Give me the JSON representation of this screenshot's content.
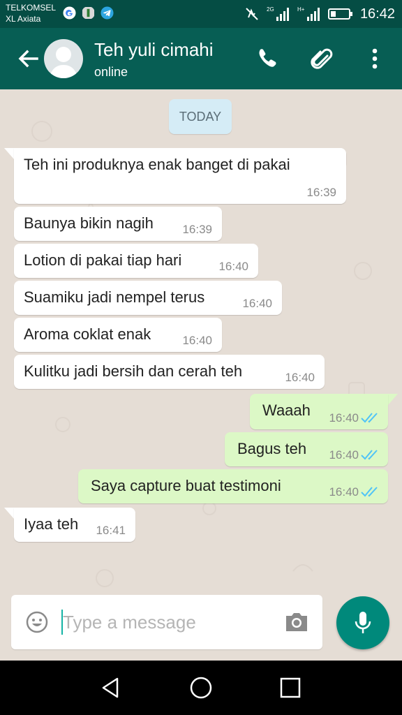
{
  "status_bar": {
    "carrier_1": "TELKOMSEL",
    "carrier_2": "XL Axiata",
    "network_1": "2G",
    "network_2": "H+",
    "time": "16:42"
  },
  "header": {
    "contact_name": "Teh yuli cimahi",
    "contact_status": "online",
    "icons": [
      "back-arrow-icon",
      "avatar",
      "phone-icon",
      "attach-icon",
      "more-icon"
    ]
  },
  "chat": {
    "date_chip": "TODAY",
    "messages": [
      {
        "dir": "in",
        "text": "Teh ini produknya enak banget di pakai",
        "time": "16:39"
      },
      {
        "dir": "in",
        "text": "Baunya bikin nagih",
        "time": "16:39"
      },
      {
        "dir": "in",
        "text": "Lotion di pakai tiap hari",
        "time": "16:40"
      },
      {
        "dir": "in",
        "text": "Suamiku jadi nempel terus",
        "time": "16:40"
      },
      {
        "dir": "in",
        "text": "Aroma coklat enak",
        "time": "16:40"
      },
      {
        "dir": "in",
        "text": "Kulitku jadi bersih dan cerah teh",
        "time": "16:40"
      },
      {
        "dir": "out",
        "text": "Waaah",
        "time": "16:40",
        "status": "read"
      },
      {
        "dir": "out",
        "text": "Bagus teh",
        "time": "16:40",
        "status": "read"
      },
      {
        "dir": "out",
        "text": "Saya capture buat testimoni",
        "time": "16:40",
        "status": "read"
      },
      {
        "dir": "in",
        "text": "Iyaa teh",
        "time": "16:41"
      }
    ]
  },
  "composer": {
    "placeholder": "Type a message"
  },
  "colors": {
    "header": "#075e54",
    "status_bar": "#054d44",
    "incoming": "#ffffff",
    "outgoing": "#dcf8c6",
    "read_ticks": "#4fc3f7",
    "mic_button": "#00897b"
  }
}
